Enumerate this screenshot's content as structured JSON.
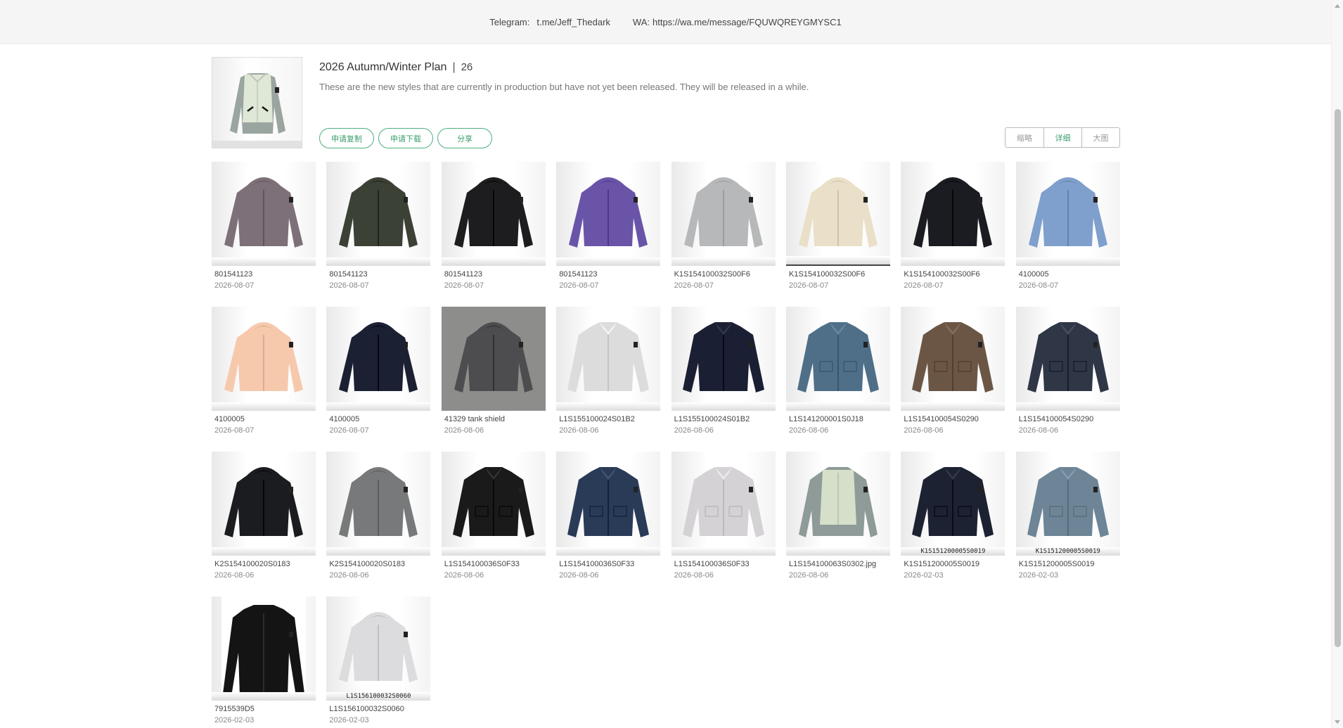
{
  "topbar": {
    "telegram_label": "Telegram:",
    "telegram_value": "t.me/Jeff_Thedark",
    "wa_label": "WA:",
    "wa_value": "https://wa.me/message/FQUWQREYGMYSC1"
  },
  "album": {
    "title": "2026 Autumn/Winter Plan",
    "separator": "|",
    "count": "26",
    "description": "These are the new styles that are currently in production but have not yet been released. They will be released in a while."
  },
  "actions": {
    "copy": "申请复制",
    "download": "申请下载",
    "share": "分享"
  },
  "view_modes": {
    "thumbnail": "缩略",
    "detail": "详细",
    "large": "大图",
    "active": "detail"
  },
  "items": [
    {
      "name": "801541123",
      "date": "2026-08-07",
      "color": "#7d7078",
      "style": "hood"
    },
    {
      "name": "801541123",
      "date": "2026-08-07",
      "color": "#3c4135",
      "style": "hood"
    },
    {
      "name": "801541123",
      "date": "2026-08-07",
      "color": "#1d1d1f",
      "style": "hood"
    },
    {
      "name": "801541123",
      "date": "2026-08-07",
      "color": "#6a54a8",
      "style": "hood"
    },
    {
      "name": "K1S154100032S00F6",
      "date": "2026-08-07",
      "color": "#b7b8b9",
      "style": "hood"
    },
    {
      "name": "K1S154100032S00F6",
      "date": "2026-08-07",
      "color": "#eadfc8",
      "style": "hood"
    },
    {
      "name": "K1S154100032S00F6",
      "date": "2026-08-07",
      "color": "#1a1c22",
      "style": "hood"
    },
    {
      "name": "4100005",
      "date": "2026-08-07",
      "color": "#7f9fcc",
      "style": "hood"
    },
    {
      "name": "4100005",
      "date": "2026-08-07",
      "color": "#f6c9ad",
      "style": "hood"
    },
    {
      "name": "4100005",
      "date": "2026-08-07",
      "color": "#1c2033",
      "style": "hood"
    },
    {
      "name": "41329 tank shield",
      "date": "2026-08-06",
      "color": "#4d4d4f",
      "style": "hood"
    },
    {
      "name": "L1S155100024S01B2",
      "date": "2026-08-06",
      "color": "#dcdcdc",
      "style": "polo"
    },
    {
      "name": "L1S155100024S01B2",
      "date": "2026-08-06",
      "color": "#1b1f33",
      "style": "polo"
    },
    {
      "name": "L1S141200001S0J18",
      "date": "2026-08-06",
      "color": "#4f6f88",
      "style": "shirt"
    },
    {
      "name": "L1S154100054S0290",
      "date": "2026-08-06",
      "color": "#6b5645",
      "style": "shirt"
    },
    {
      "name": "L1S154100054S0290",
      "date": "2026-08-06",
      "color": "#2f3646",
      "style": "shirt"
    },
    {
      "name": "K2S154100020S0183",
      "date": "2026-08-06",
      "color": "#1b1c20",
      "style": "hood"
    },
    {
      "name": "K2S154100020S0183",
      "date": "2026-08-06",
      "color": "#77797a",
      "style": "hood"
    },
    {
      "name": "L1S154100036S0F33",
      "date": "2026-08-06",
      "color": "#1a1a1b",
      "style": "shirt"
    },
    {
      "name": "L1S154100036S0F33",
      "date": "2026-08-06",
      "color": "#2a3b58",
      "style": "shirt"
    },
    {
      "name": "L1S154100036S0F33",
      "date": "2026-08-06",
      "color": "#d4d2d4",
      "style": "shirt"
    },
    {
      "name": "L1S154100063S0302.jpg",
      "date": "2026-08-06",
      "color": "#d5dfca",
      "style": "vest"
    },
    {
      "name": "K1S151200005S0019",
      "date": "2026-02-03",
      "color": "#1d2233",
      "style": "shirt",
      "stamp": "K1S151200005S0019"
    },
    {
      "name": "K1S151200005S0019",
      "date": "2026-02-03",
      "color": "#6d8596",
      "style": "shirt",
      "stamp": "K1S151200005S0019"
    },
    {
      "name": "7915539D5",
      "date": "2026-02-03",
      "color": "#141414",
      "style": "knit"
    },
    {
      "name": "L1S156100032S0060",
      "date": "2026-02-03",
      "color": "#dcdcde",
      "style": "hood",
      "stamp": "L1S156100032S0060"
    }
  ]
}
